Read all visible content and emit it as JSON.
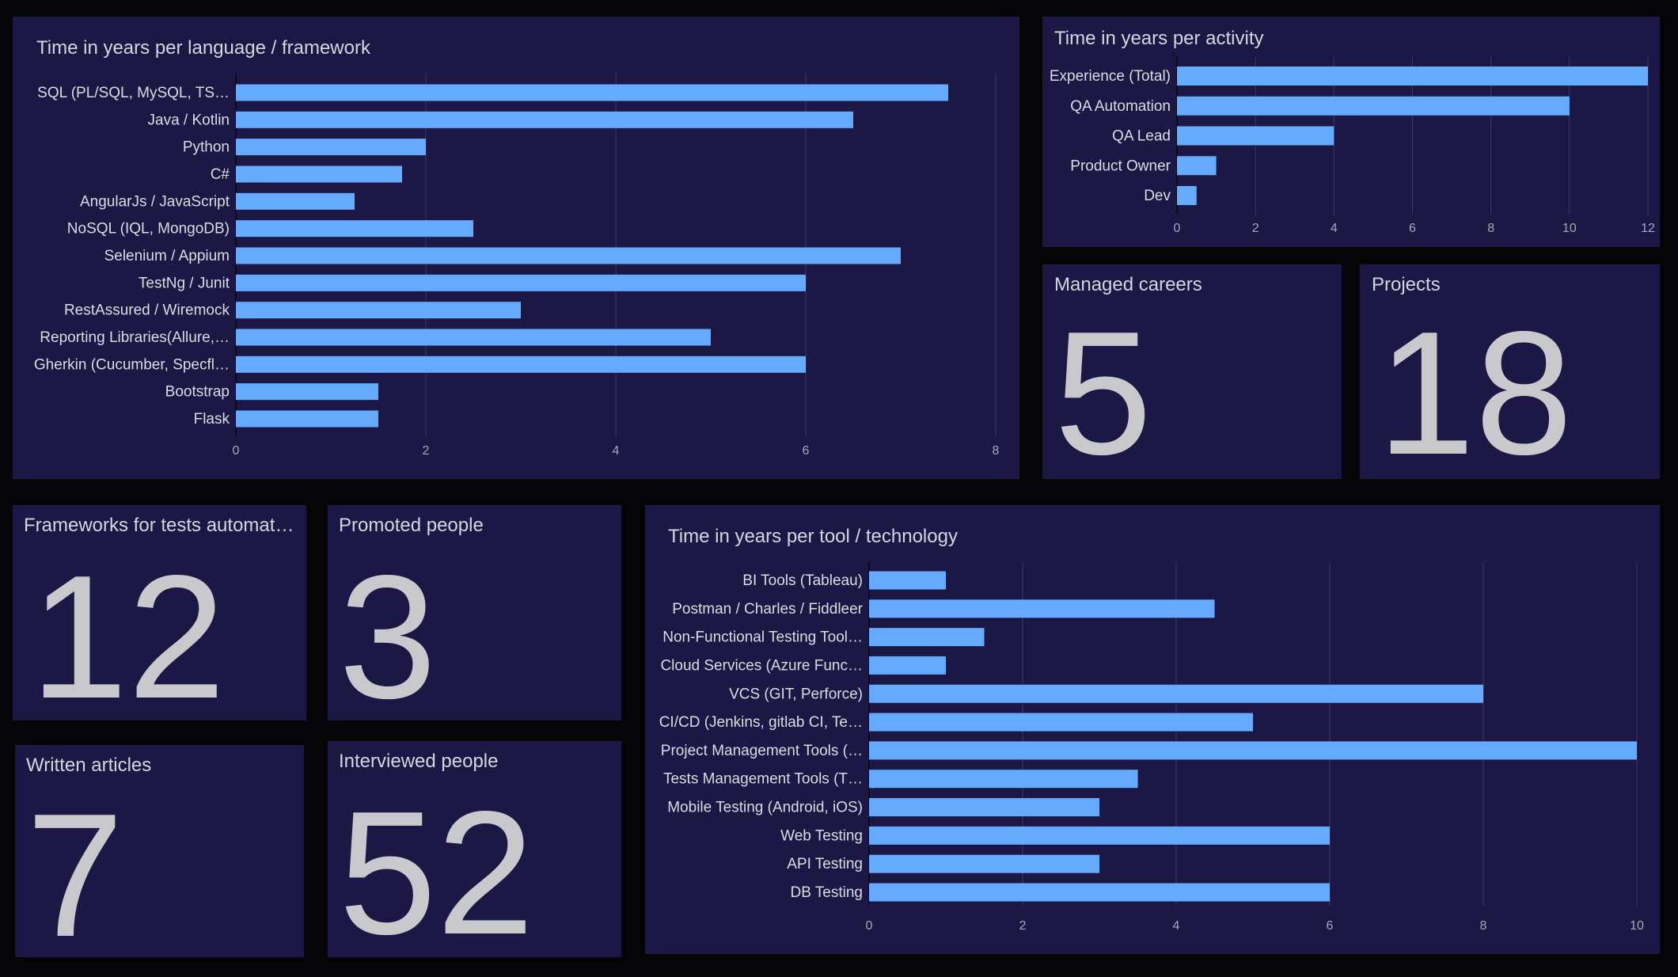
{
  "colors": {
    "background": "#050508",
    "panel": "#1c1744",
    "bar": "#64aaff",
    "grid": "#3d3a66",
    "title": "#d6d6e0",
    "number": "#c9c9cd"
  },
  "kpis": {
    "managed_careers": {
      "title": "Managed careers",
      "value": "5"
    },
    "projects": {
      "title": "Projects",
      "value": "18"
    },
    "frameworks": {
      "title": "Frameworks for tests automation",
      "value": "12"
    },
    "promoted": {
      "title": "Promoted people",
      "value": "3"
    },
    "articles": {
      "title": "Written articles",
      "value": "7"
    },
    "interviewed": {
      "title": "Interviewed people",
      "value": "52"
    }
  },
  "chart_data": [
    {
      "id": "languages",
      "type": "bar",
      "orientation": "horizontal",
      "title": "Time in years per language / framework",
      "categories": [
        "SQL (PL/SQL, MySQL, TS…",
        "Java / Kotlin",
        "Python",
        "C#",
        "AngularJs / JavaScript",
        "NoSQL (IQL, MongoDB)",
        "Selenium / Appium",
        "TestNg / Junit",
        "RestAssured / Wiremock",
        "Reporting Libraries(Allure,…",
        "Gherkin (Cucumber, Specfl…",
        "Bootstrap",
        "Flask"
      ],
      "values": [
        7.5,
        6.5,
        2,
        1.75,
        1.25,
        2.5,
        7,
        6,
        3,
        5,
        6,
        1.5,
        1.5
      ],
      "xlim": [
        0,
        8
      ],
      "xticks": [
        0,
        2,
        4,
        6,
        8
      ],
      "grid": true
    },
    {
      "id": "activity",
      "type": "bar",
      "orientation": "horizontal",
      "title": "Time in years per activity",
      "categories": [
        "Experience (Total)",
        "QA Automation",
        "QA Lead",
        "Product Owner",
        "Dev"
      ],
      "values": [
        12,
        10,
        4,
        1,
        0.5
      ],
      "xlim": [
        0,
        12
      ],
      "xticks": [
        0,
        2,
        4,
        6,
        8,
        10,
        12
      ],
      "grid": true
    },
    {
      "id": "tools",
      "type": "bar",
      "orientation": "horizontal",
      "title": "Time in years per tool / technology",
      "categories": [
        "BI Tools (Tableau)",
        "Postman / Charles / Fiddleer",
        "Non-Functional Testing Tool…",
        "Cloud Services (Azure Func…",
        "VCS (GIT, Perforce)",
        "CI/CD (Jenkins, gitlab CI, Te…",
        "Project Management Tools (…",
        "Tests Management Tools (T…",
        "Mobile Testing (Android, iOS)",
        "Web Testing",
        "API Testing",
        "DB Testing"
      ],
      "values": [
        1,
        4.5,
        1.5,
        1,
        8,
        5,
        10,
        3.5,
        3,
        6,
        3,
        6
      ],
      "xlim": [
        0,
        10
      ],
      "xticks": [
        0,
        2,
        4,
        6,
        8,
        10
      ],
      "grid": true
    }
  ]
}
